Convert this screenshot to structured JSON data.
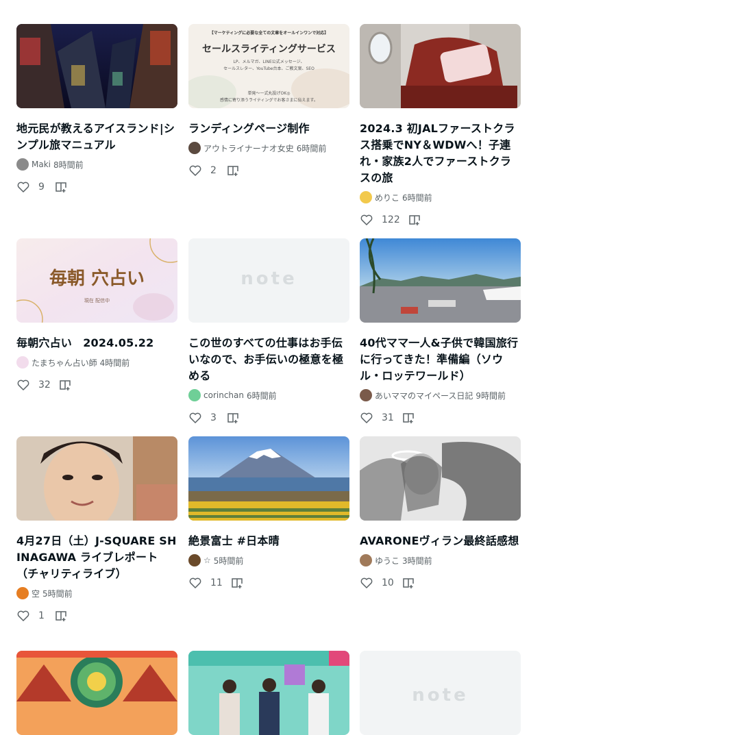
{
  "cards": [
    {
      "title": "地元民が教えるアイスランド|シンプル旅マニュアル",
      "author": "Maki",
      "time": "8時間前",
      "likes": "9"
    },
    {
      "title": "ランディングページ制作",
      "author": "アウトライナーナオ女史",
      "time": "6時間前",
      "likes": "2",
      "thumb": {
        "line1": "【マーケティングに必要な全ての文章をオールインワンで対応】",
        "line2": "セールスライティングサービス",
        "line3": "LP、メルマガ、LINE公式メッセージ、",
        "line4": "セールスレター、YouTube台本、ご教文案、SEO",
        "line5": "単発〜一式丸投げOK◎",
        "line6": "感情に寄り添うライティングでお客さまに伝えます。"
      }
    },
    {
      "title": "2024.3 初JALファーストクラス搭乗でNY＆WDWへ！子連れ・家族2人でファーストクラスの旅",
      "author": "めりこ",
      "time": "6時間前",
      "likes": "122"
    },
    {
      "title": "毎朝穴占い　2024.05.22",
      "author": "たまちゃん占い師",
      "time": "4時間前",
      "likes": "32",
      "thumb": {
        "main": "毎朝 穴占い",
        "sub": "現在 配信中"
      }
    },
    {
      "title": "この世のすべての仕事はお手伝いなので、お手伝いの極意を極める",
      "author": "corinchan",
      "time": "6時間前",
      "likes": "3",
      "thumb": {
        "logo": "note"
      }
    },
    {
      "title": "40代ママ一人&子供で韓国旅行に行ってきた！準備編（ソウル・ロッテワールド）",
      "author": "あいママのマイペース日記",
      "time": "9時間前",
      "likes": "31"
    },
    {
      "title": "4月27日（土）J-SQUARE SHINAGAWA ライブレポート（チャリティライブ）",
      "author": "空",
      "time": "5時間前",
      "likes": "1"
    },
    {
      "title": "絶景富士 #日本晴",
      "author": "☆",
      "time": "5時間前",
      "likes": "11"
    },
    {
      "title": "AVARONEヴィラン最終話感想",
      "author": "ゆうこ",
      "time": "3時間前",
      "likes": "10"
    },
    {
      "title": "",
      "author": "",
      "time": "",
      "likes": ""
    },
    {
      "title": "",
      "author": "",
      "time": "",
      "likes": ""
    },
    {
      "title": "",
      "author": "",
      "time": "",
      "likes": "",
      "thumb": {
        "logo": "note"
      }
    }
  ],
  "colors": {
    "accent": "#08131a",
    "muted": "#5a6266",
    "placeholder": "#f2f4f5"
  }
}
